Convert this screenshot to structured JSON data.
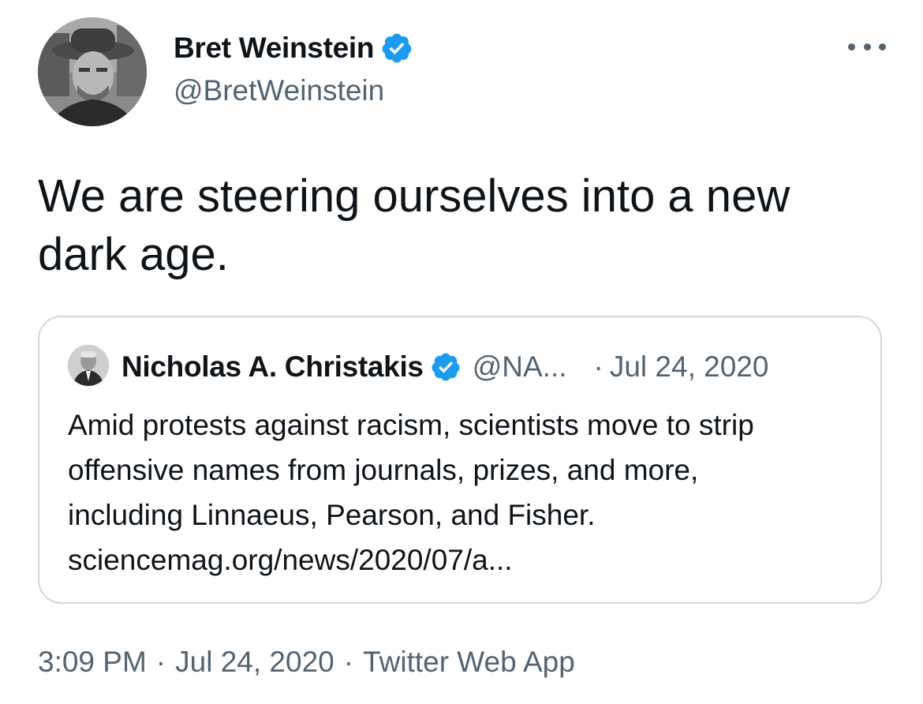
{
  "author": {
    "display_name": "Bret Weinstein",
    "handle": "@BretWeinstein",
    "verified": true
  },
  "tweet": {
    "text_lines": [
      "We are steering ourselves into a new",
      "dark age."
    ]
  },
  "quoted_tweet": {
    "display_name": "Nicholas A. Christakis",
    "handle": "@NA...",
    "separator": "·",
    "date": "Jul 24, 2020",
    "text_lines": [
      "Amid protests against racism, scientists move to strip",
      "offensive names from journals, prizes, and more,",
      "including Linnaeus, Pearson, and Fisher.",
      "sciencemag.org/news/2020/07/a..."
    ]
  },
  "footer": {
    "time": "3:09 PM",
    "date": "Jul 24, 2020",
    "source": "Twitter Web App",
    "separator": "·"
  },
  "icons": {
    "verified": "verified-badge-icon",
    "more": "more-options-icon"
  },
  "colors": {
    "verified_blue": "#1d9bf0",
    "text_primary": "#0f1419",
    "text_secondary": "#536471",
    "border": "#cfd9de"
  }
}
